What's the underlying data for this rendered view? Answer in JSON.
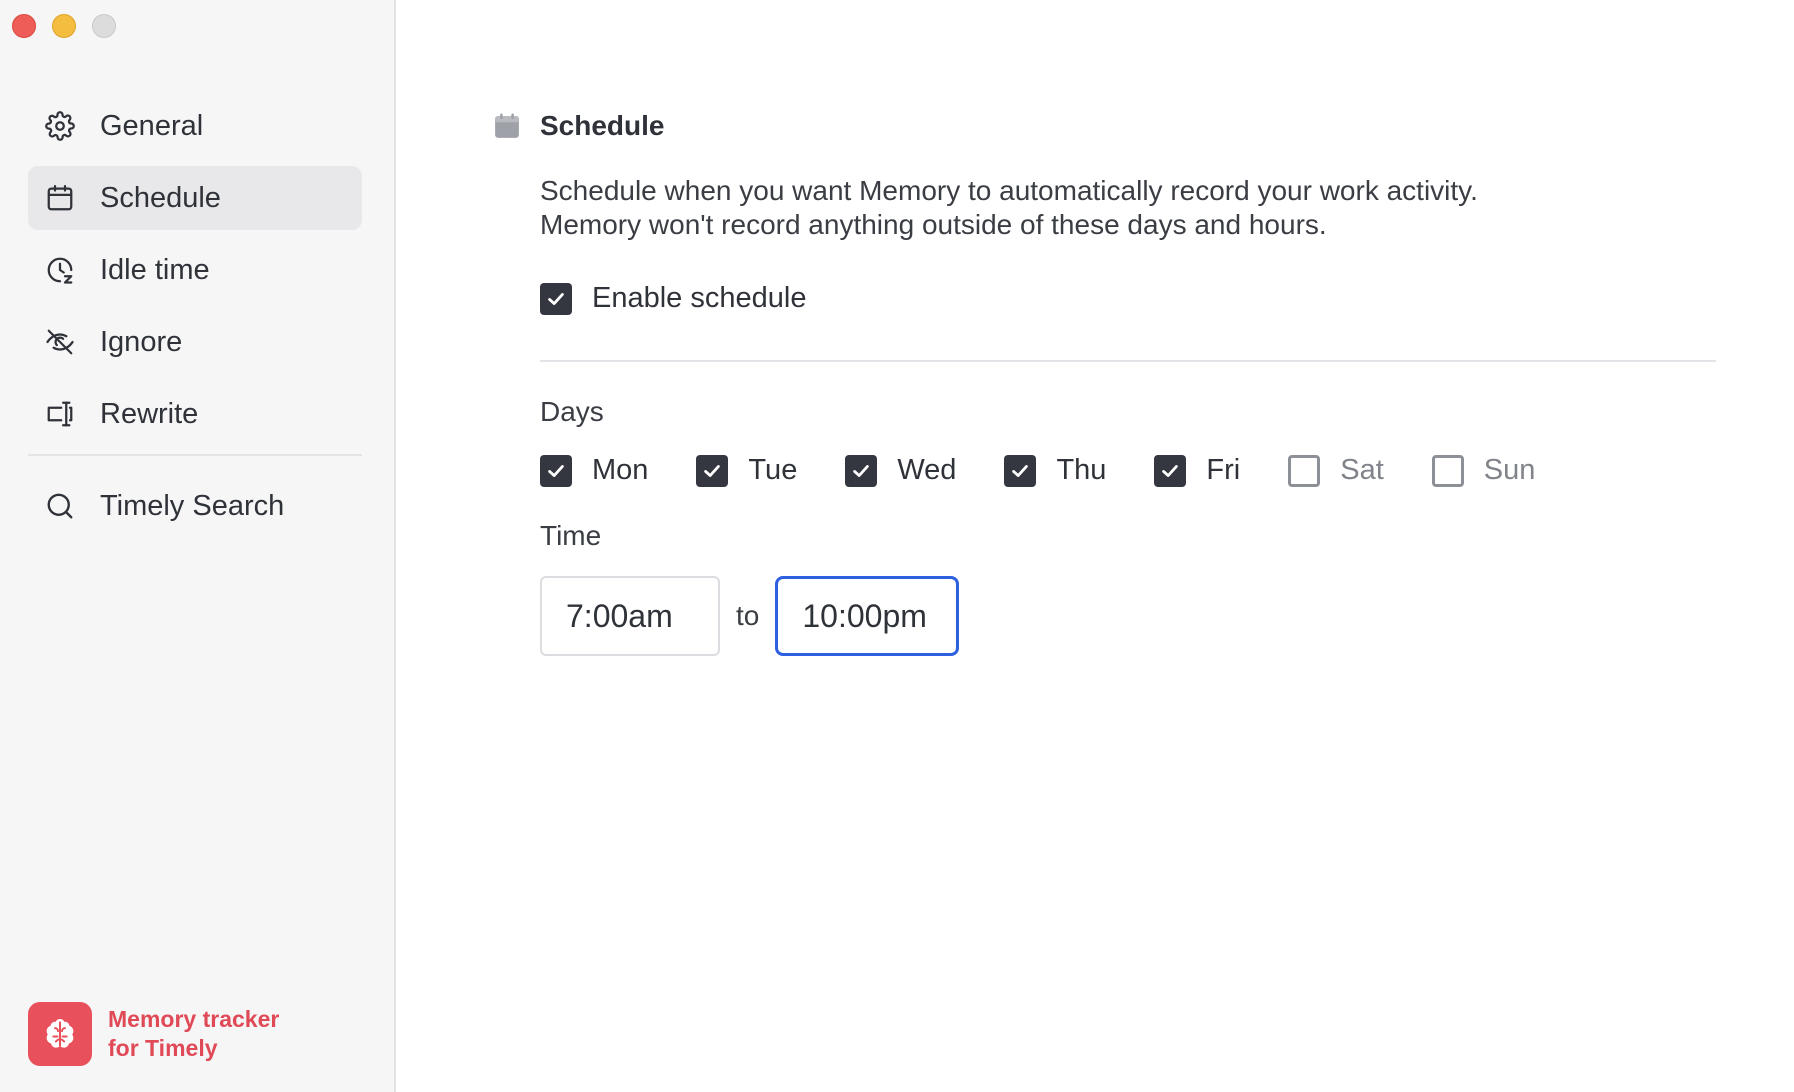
{
  "window": {
    "controls": [
      "close",
      "minimize",
      "zoom"
    ]
  },
  "sidebar": {
    "items": [
      {
        "label": "General",
        "icon": "gear-icon",
        "active": false
      },
      {
        "label": "Schedule",
        "icon": "calendar-icon",
        "active": true
      },
      {
        "label": "Idle time",
        "icon": "clock-idle-icon",
        "active": false
      },
      {
        "label": "Ignore",
        "icon": "eye-slash-icon",
        "active": false
      },
      {
        "label": "Rewrite",
        "icon": "text-cursor-icon",
        "active": false
      }
    ],
    "secondary_items": [
      {
        "label": "Timely Search",
        "icon": "search-icon",
        "active": false
      }
    ],
    "brand": {
      "line1": "Memory tracker",
      "line2": "for Timely",
      "icon": "brain-icon",
      "color": "#e8505b"
    }
  },
  "main": {
    "section_title": "Schedule",
    "section_icon": "calendar-icon",
    "description_line1": "Schedule when you want Memory to automatically record your work activity.",
    "description_line2": "Memory won't record anything outside of these days and hours.",
    "enable_schedule": {
      "label": "Enable schedule",
      "checked": true
    },
    "days_label": "Days",
    "days": [
      {
        "label": "Mon",
        "checked": true
      },
      {
        "label": "Tue",
        "checked": true
      },
      {
        "label": "Wed",
        "checked": true
      },
      {
        "label": "Thu",
        "checked": true
      },
      {
        "label": "Fri",
        "checked": true
      },
      {
        "label": "Sat",
        "checked": false
      },
      {
        "label": "Sun",
        "checked": false
      }
    ],
    "time_label": "Time",
    "time_from": "7:00am",
    "time_separator": "to",
    "time_to": "10:00pm"
  },
  "colors": {
    "accent_focus": "#2d5fe0",
    "checkbox_checked": "#343740",
    "brand": "#e04a57"
  }
}
